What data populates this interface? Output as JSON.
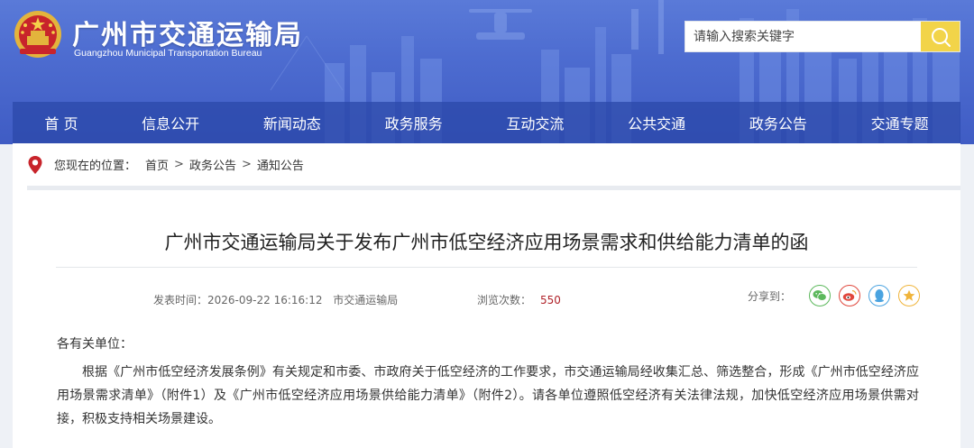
{
  "header": {
    "title": "广州市交通运输局",
    "subtitle": "Guangzhou Municipal Transportation Bureau",
    "search_placeholder": "请输入搜索关键字",
    "colors": {
      "header_blue": "#4d6cd0",
      "nav_blue": "#2c49aa",
      "search_button": "#f2d449"
    }
  },
  "nav": {
    "items": [
      "首 页",
      "信息公开",
      "新闻动态",
      "政务服务",
      "互动交流",
      "公共交通",
      "政务公告",
      "交通专题"
    ]
  },
  "breadcrumb": {
    "prefix": "您现在的位置：",
    "items": [
      "首页",
      "政务公告",
      "通知公告"
    ],
    "separator": ">"
  },
  "article": {
    "title": "广州市交通运输局关于发布广州市低空经济应用场景需求和供给能力清单的函",
    "publish_label": "发表时间：",
    "publish_time": "2026-09-22 16:16:12",
    "source": "市交通运输局",
    "views_label": "浏览次数：",
    "views": "550",
    "share_label": "分享到：",
    "share_icons": [
      "wechat-icon",
      "weibo-icon",
      "qq-icon",
      "qzone-icon"
    ],
    "salutation": "各有关单位：",
    "paragraph": "根据《广州市低空经济发展条例》有关规定和市委、市政府关于低空经济的工作要求，市交通运输局经收集汇总、筛选整合，形成《广州市低空经济应用场景需求清单》（附件1）及《广州市低空经济应用场景供给能力清单》（附件2）。请各单位遵照低空经济有关法律法规，加快低空经济应用场景供需对接，积极支持相关场景建设。"
  }
}
